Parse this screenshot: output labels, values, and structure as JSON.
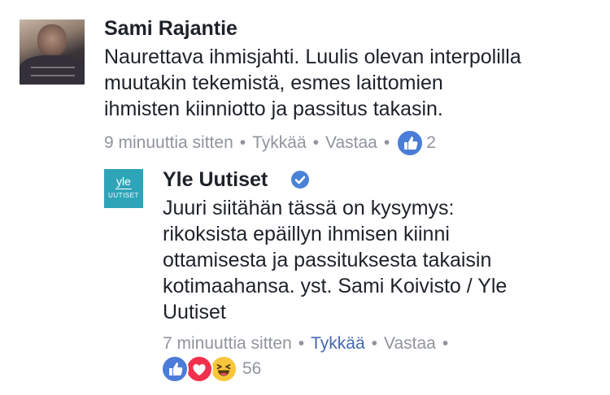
{
  "comments": [
    {
      "author": "Sami Rajantie",
      "text_lines": [
        "Naurettava ihmisjahti. Luulis olevan interpolilla",
        "muutakin tekemistä, esmes laittomien",
        "ihmisten kiinniotto ja passitus takasin."
      ],
      "time": "9 minuuttia sitten",
      "sep": "•",
      "like_label": "Tykkää",
      "reply_label": "Vastaa",
      "reaction_count": "2"
    }
  ],
  "reply": {
    "author": "Yle Uutiset",
    "avatar_word": "yle",
    "avatar_sub": "UUTISET",
    "text_lines": [
      "Juuri siitähän tässä on kysymys:",
      "rikoksista epäillyn ihmisen kiinni",
      "ottamisesta ja passituksesta takaisin",
      "kotimaahansa. yst. Sami Koivisto / Yle",
      "Uutiset"
    ],
    "time": "7 minuuttia sitten",
    "sep": "•",
    "like_label": "Tykkää",
    "reply_label": "Vastaa",
    "reaction_count": "56"
  },
  "colors": {
    "text": "#1d2129",
    "meta": "#90949c",
    "link_active": "#4267b2",
    "like": "#4a7cd8",
    "love": "#f0304d",
    "haha": "#f7c63b",
    "yle_teal": "#2fa3b8"
  },
  "icons": [
    "like-icon",
    "love-icon",
    "haha-icon",
    "verified-badge-icon"
  ]
}
